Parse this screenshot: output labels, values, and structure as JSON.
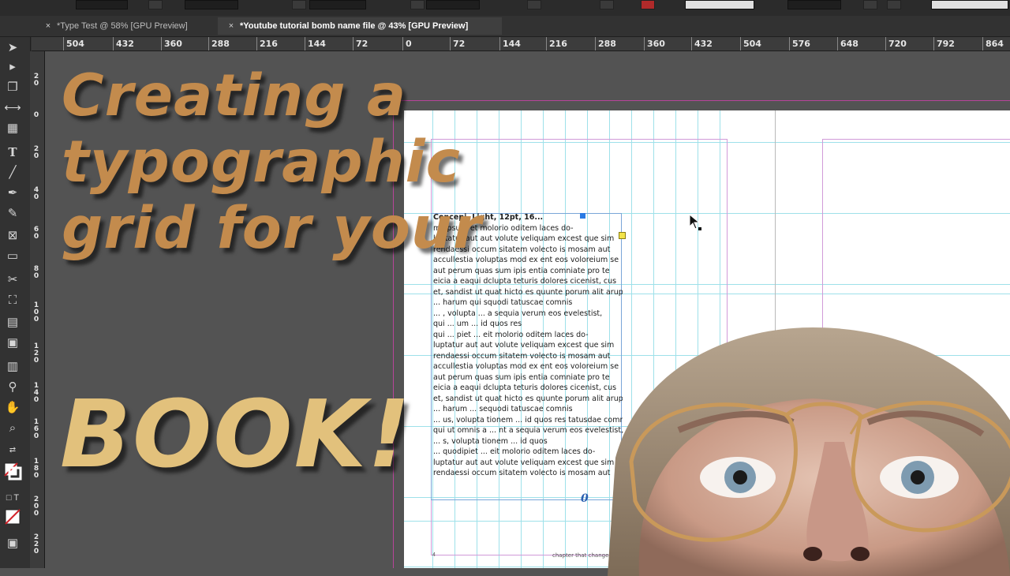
{
  "tabs": [
    {
      "label": "*Type Test @ 58% [GPU Preview]",
      "active": false
    },
    {
      "label": "*Youtube tutorial bomb name file @ 43% [GPU Preview]",
      "active": true
    }
  ],
  "tab_close": "×",
  "horizontal_ruler": [
    "504",
    "432",
    "360",
    "288",
    "216",
    "144",
    "72",
    "0",
    "72",
    "144",
    "216",
    "288",
    "360",
    "432",
    "504",
    "576",
    "648",
    "720",
    "792",
    "864"
  ],
  "vertical_ruler": [
    "2 0",
    "0",
    "2 0",
    "4 0",
    "6 0",
    "8 0",
    "1 0 0",
    "1 2 0",
    "1 4 0",
    "1 6 0",
    "1 8 0",
    "2 0 0",
    "2 2 0"
  ],
  "tools": [
    "selection-tool",
    "direct-selection-tool",
    "page-tool",
    "gap-tool",
    "content-collector-tool",
    "type-tool",
    "line-tool",
    "pen-tool",
    "pencil-tool",
    "rectangle-frame-tool",
    "rectangle-tool",
    "scissors-tool",
    "free-transform-tool",
    "gradient-swatch-tool",
    "gradient-feather-tool",
    "note-tool",
    "eyedropper-tool",
    "hand-tool",
    "zoom-tool",
    "fill-stroke-swatch",
    "format-container",
    "format-text",
    "apply-none",
    "screen-mode"
  ],
  "thumbnail": {
    "title_lines": [
      "Creating a",
      "typographic",
      "grid for your"
    ],
    "emphasis": "BOOK!"
  },
  "document": {
    "overset_marker": "0",
    "folio": "chapter that changed yo",
    "page_number": "4",
    "body_lines": [
      "Concepi, Light, 12pt, 16...",
      "mi ipsum et molorio oditem laces do-",
      "luptatur aut aut volute veliquam excest que sim",
      "rendaessi occum sitatem volecto is mosam aut",
      "accullestia voluptas mod ex ent eos voloreium se",
      "aut perum quas sum ipis entia comniate pro te",
      "eicia a eaqui dclupta teturis dolores cicenist, cus",
      "et, sandist ut quat hicto es quunte porum alit arupis",
      "... harum qui squodi tatuscae comnis",
      "... , volupta ... a sequia verum eos evelestist,",
      "qui ... um ... id quos res",
      "qui ... piet ... eit molorio oditem laces do-",
      "luptatur aut aut volute veliquam excest que sim",
      "rendaessi occum sitatem volecto is mosam aut",
      "accullestia voluptas mod ex ent eos voloreium se",
      "aut perum quas sum ipis entia comniate pro te",
      "eicia a eaqui dclupta teturis dolores cicenist, cus",
      "et, sandist ut quat hicto es quunte porum alit arupis",
      "... harum ... sequodi tatuscae comnis",
      "... us, volupta tionem ... id quos res tatusdae comnis",
      "qui ut omnis a ... nt a sequia verum eos evelestist,",
      "... s, volupta tionem ... id quos",
      "... quodipiet ... eit molorio oditem laces do-",
      "luptatur aut aut volute veliquam excest que sim",
      "rendaessi occum sitatem volecto is mosam aut"
    ]
  },
  "colors": {
    "title": "#c38b4d",
    "emphasis": "#e2c17c",
    "guides": "#9ee1ea",
    "margins": "#d19ad8",
    "pasteboard": "#535353"
  }
}
